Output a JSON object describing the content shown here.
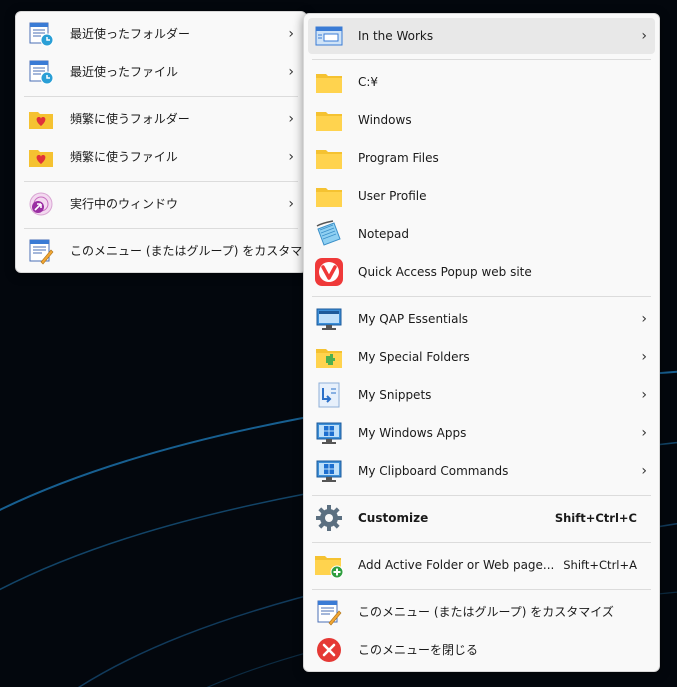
{
  "left_menu": {
    "items": [
      {
        "label": "最近使ったフォルダー",
        "icon": "recent-folders-icon",
        "has_submenu": true,
        "submenu_indicator": "›"
      },
      {
        "label": "最近使ったファイル",
        "icon": "recent-files-icon",
        "has_submenu": true,
        "submenu_indicator": "›"
      },
      {
        "label": "頻繁に使うフォルダー",
        "icon": "frequent-folders-icon",
        "has_submenu": true,
        "submenu_indicator": "›"
      },
      {
        "label": "頻繁に使うファイル",
        "icon": "frequent-files-icon",
        "has_submenu": true,
        "submenu_indicator": "›"
      },
      {
        "label": "実行中のウィンドウ",
        "icon": "running-windows-icon",
        "has_submenu": true,
        "submenu_indicator": "›"
      },
      {
        "label": "このメニュー (またはグループ) をカスタマイズ",
        "icon": "customize-menu-icon",
        "has_submenu": false
      }
    ]
  },
  "right_menu": {
    "items": [
      {
        "label": "In the Works",
        "icon": "in-the-works-icon",
        "has_submenu": true,
        "submenu_indicator": "›",
        "highlighted": true
      },
      {
        "label": "C:¥",
        "icon": "folder-icon"
      },
      {
        "label": "Windows",
        "icon": "folder-icon"
      },
      {
        "label": "Program Files",
        "icon": "folder-icon"
      },
      {
        "label": "User Profile",
        "icon": "folder-icon"
      },
      {
        "label": "Notepad",
        "icon": "notepad-icon"
      },
      {
        "label": "Quick Access Popup web site",
        "icon": "vivaldi-icon"
      },
      {
        "label": "My QAP Essentials",
        "icon": "monitor-icon",
        "has_submenu": true,
        "submenu_indicator": "›"
      },
      {
        "label": "My Special Folders",
        "icon": "special-folder-icon",
        "has_submenu": true,
        "submenu_indicator": "›"
      },
      {
        "label": "My Snippets",
        "icon": "snippets-icon",
        "has_submenu": true,
        "submenu_indicator": "›"
      },
      {
        "label": "My Windows Apps",
        "icon": "windows-apps-icon",
        "has_submenu": true,
        "submenu_indicator": "›"
      },
      {
        "label": "My Clipboard Commands",
        "icon": "clipboard-commands-icon",
        "has_submenu": true,
        "submenu_indicator": "›"
      },
      {
        "label": "Customize",
        "icon": "gear-icon",
        "shortcut": "Shift+Ctrl+C",
        "bold": true
      },
      {
        "label": "Add Active Folder or Web page...",
        "icon": "add-folder-icon",
        "shortcut": "Shift+Ctrl+A"
      },
      {
        "label": "このメニュー (またはグループ) をカスタマイズ",
        "icon": "customize-menu-icon"
      },
      {
        "label": "このメニューを閉じる",
        "icon": "close-icon"
      }
    ]
  },
  "colors": {
    "menu_bg": "#f9f9f9",
    "highlight_bg": "#e8e8e8",
    "folder_yellow": "#f5c231",
    "desktop_bg": "#03070d",
    "close_red": "#e53935"
  }
}
